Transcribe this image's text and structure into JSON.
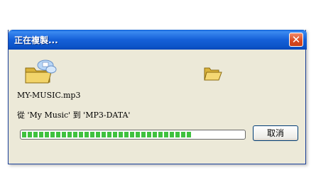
{
  "window": {
    "title": "正在複製...",
    "close_label": "✕"
  },
  "icons": {
    "source": "folder-with-flying-paper-icon",
    "destination": "open-folder-icon"
  },
  "copy": {
    "file_name": "MY-MUSIC.mp3",
    "from_to": "從 'My Music' 到 'MP3-DATA'",
    "progress_fraction": 0.77
  },
  "buttons": {
    "cancel_label": "取消"
  },
  "colors": {
    "titlebar": "#0c54c8",
    "close_button": "#d8481e",
    "progress_fill": "#3fc13f",
    "dialog_background": "#ece9d8"
  }
}
